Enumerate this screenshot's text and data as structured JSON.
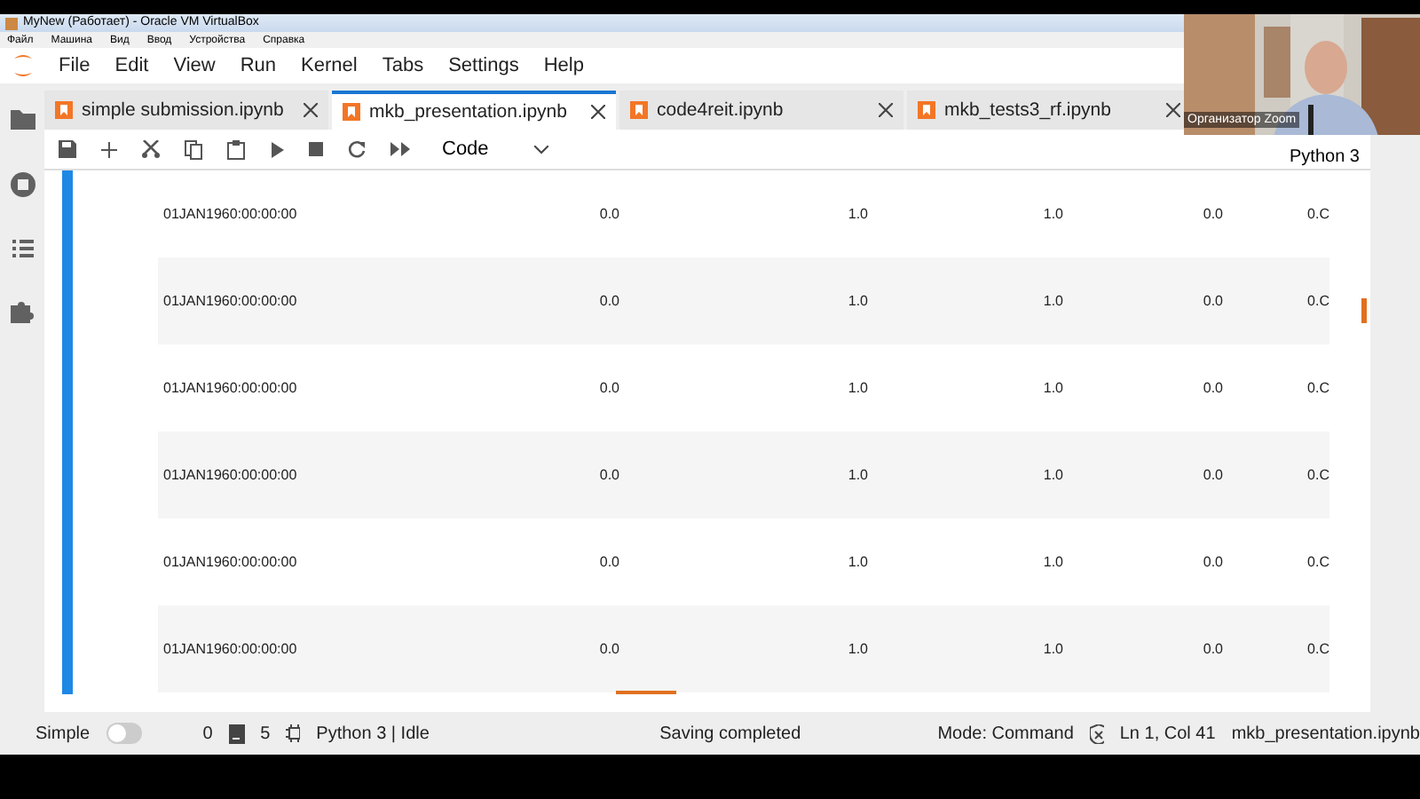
{
  "host_window": {
    "title": "MyNew (Работает) - Oracle VM VirtualBox",
    "menu": [
      "Файл",
      "Машина",
      "Вид",
      "Ввод",
      "Устройства",
      "Справка"
    ]
  },
  "menubar": [
    "File",
    "Edit",
    "View",
    "Run",
    "Kernel",
    "Tabs",
    "Settings",
    "Help"
  ],
  "tabs": [
    {
      "label": "simple submission.ipynb",
      "selected": false
    },
    {
      "label": "mkb_presentation.ipynb",
      "selected": true
    },
    {
      "label": "code4reit.ipynb",
      "selected": false
    },
    {
      "label": "mkb_tests3_rf.ipynb",
      "selected": false
    }
  ],
  "toolbar": {
    "cell_type": "Code",
    "kernel": "Python 3"
  },
  "table": {
    "rows": [
      [
        "01JAN1960:00:00:00",
        "0.0",
        "1.0",
        "1.0",
        "0.0",
        "0.C"
      ],
      [
        "01JAN1960:00:00:00",
        "0.0",
        "1.0",
        "1.0",
        "0.0",
        "0.C"
      ],
      [
        "01JAN1960:00:00:00",
        "0.0",
        "1.0",
        "1.0",
        "0.0",
        "0.C"
      ],
      [
        "01JAN1960:00:00:00",
        "0.0",
        "1.0",
        "1.0",
        "0.0",
        "0.C"
      ],
      [
        "01JAN1960:00:00:00",
        "0.0",
        "1.0",
        "1.0",
        "0.0",
        "0.C"
      ],
      [
        "01JAN1960:00:00:00",
        "0.0",
        "1.0",
        "1.0",
        "0.0",
        "0.C"
      ]
    ]
  },
  "status_bar": {
    "simple_label": "Simple",
    "simple_on": false,
    "count_a": "0",
    "count_b": "5",
    "kernel_status": "Python 3 | Idle",
    "message": "Saving completed",
    "mode": "Mode: Command",
    "position": "Ln 1, Col 41",
    "file": "mkb_presentation.ipynb"
  },
  "video_overlay": {
    "kind": "picture",
    "caption": "Организатор Zoom"
  }
}
